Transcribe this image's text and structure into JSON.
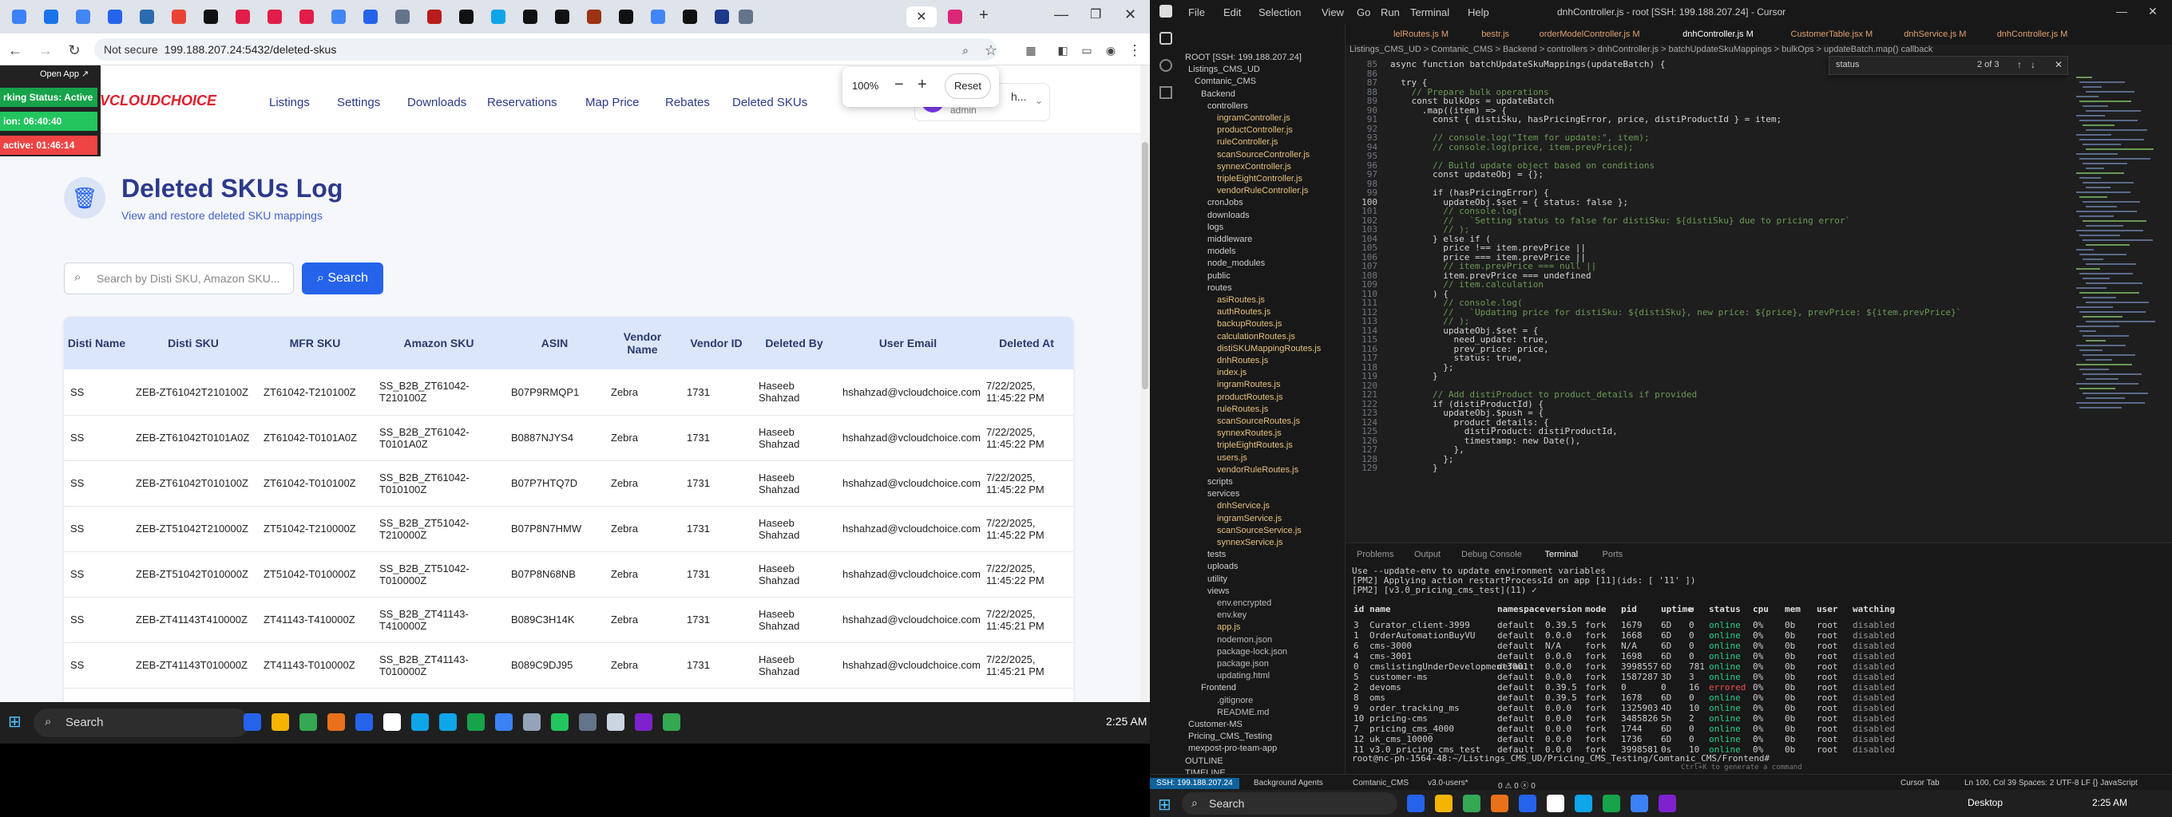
{
  "browser": {
    "url": "199.188.207.24:5432/deleted-skus",
    "not_secure": "Not secure",
    "zoom_value": "100%",
    "zoom_minus": "−",
    "zoom_plus": "+",
    "zoom_reset": "Reset",
    "open_app": "Open App ↗"
  },
  "status_widget": {
    "status": "rking Status: Active",
    "break": "ion: 06:40:40",
    "active": "active: 01:46:14"
  },
  "site": {
    "logo": "VCLOUDCHOICE",
    "nav": [
      "Listings",
      "Settings",
      "Downloads",
      "Reservations",
      "Map Price",
      "Rebates",
      "Deleted SKUs"
    ],
    "user_name": "h...",
    "user_role": "admin"
  },
  "page": {
    "title": "Deleted SKUs Log",
    "subtitle": "View and restore deleted SKU mappings",
    "search_placeholder": "Search by Disti SKU, Amazon SKU...",
    "search_button": "Search"
  },
  "table": {
    "headers": [
      "Disti Name",
      "Disti SKU",
      "MFR SKU",
      "Amazon SKU",
      "ASIN",
      "Vendor Name",
      "Vendor ID",
      "Deleted By",
      "User Email",
      "Deleted At"
    ],
    "rows": [
      [
        "SS",
        "ZEB-ZT61042T210100Z",
        "ZT61042-T210100Z",
        "SS_B2B_ZT61042-T210100Z",
        "B07P9RMQP1",
        "Zebra",
        "1731",
        "Haseeb Shahzad",
        "hshahzad@vcloudchoice.com",
        "7/22/2025, 11:45:22 PM"
      ],
      [
        "SS",
        "ZEB-ZT61042T0101A0Z",
        "ZT61042-T0101A0Z",
        "SS_B2B_ZT61042-T0101A0Z",
        "B0887NJYS4",
        "Zebra",
        "1731",
        "Haseeb Shahzad",
        "hshahzad@vcloudchoice.com",
        "7/22/2025, 11:45:22 PM"
      ],
      [
        "SS",
        "ZEB-ZT61042T010100Z",
        "ZT61042-T010100Z",
        "SS_B2B_ZT61042-T010100Z",
        "B07P7HTQ7D",
        "Zebra",
        "1731",
        "Haseeb Shahzad",
        "hshahzad@vcloudchoice.com",
        "7/22/2025, 11:45:22 PM"
      ],
      [
        "SS",
        "ZEB-ZT51042T210000Z",
        "ZT51042-T210000Z",
        "SS_B2B_ZT51042-T210000Z",
        "B07P8N7HMW",
        "Zebra",
        "1731",
        "Haseeb Shahzad",
        "hshahzad@vcloudchoice.com",
        "7/22/2025, 11:45:22 PM"
      ],
      [
        "SS",
        "ZEB-ZT51042T010000Z",
        "ZT51042-T010000Z",
        "SS_B2B_ZT51042-T010000Z",
        "B07P8N68NB",
        "Zebra",
        "1731",
        "Haseeb Shahzad",
        "hshahzad@vcloudchoice.com",
        "7/22/2025, 11:45:22 PM"
      ],
      [
        "SS",
        "ZEB-ZT41143T410000Z",
        "ZT41143-T410000Z",
        "SS_B2B_ZT41143-T410000Z",
        "B089C3H14K",
        "Zebra",
        "1731",
        "Haseeb Shahzad",
        "hshahzad@vcloudchoice.com",
        "7/22/2025, 11:45:21 PM"
      ],
      [
        "SS",
        "ZEB-ZT41143T010000Z",
        "ZT41143-T010000Z",
        "SS_B2B_ZT41143-T010000Z",
        "B089C9DJ95",
        "Zebra",
        "1731",
        "Haseeb Shahzad",
        "hshahzad@vcloudchoice.com",
        "7/22/2025, 11:45:21 PM"
      ]
    ]
  },
  "taskbar_left": {
    "search": "Search",
    "time": "2:25 AM"
  },
  "editor": {
    "title": "dnhController.js - root [SSH: 199.188.207.24] - Cursor",
    "menus": [
      "File",
      "Edit",
      "Selection",
      "View",
      "Go",
      "Run",
      "Terminal",
      "Help"
    ],
    "tabs": [
      "lelRoutes.js M",
      "bestr.js",
      "orderModelController.js M",
      "dnhController.js M",
      "CustomerTable.jsx M",
      "dnhService.js M",
      "dnhController.js M"
    ],
    "breadcrumb": "Listings_CMS_UD > Comtanic_CMS > Backend > controllers > dnhController.js > batchUpdateSkuMappings > bulkOps > updateBatch.map() callback",
    "find_text": "status",
    "find_count": "2 of 3",
    "files": [
      "ROOT [SSH: 199.188.207.24]",
      "Listings_CMS_UD",
      "Comtanic_CMS",
      "Backend",
      "controllers",
      "ingramController.js",
      "productController.js",
      "ruleController.js",
      "scanSourceController.js",
      "synnexController.js",
      "tripleEightController.js",
      "vendorRuleController.js",
      "cronJobs",
      "downloads",
      "logs",
      "middleware",
      "models",
      "node_modules",
      "public",
      "routes",
      "asiRoutes.js",
      "authRoutes.js",
      "backupRoutes.js",
      "calculationRoutes.js",
      "distiSKUMappingRoutes.js",
      "dnhRoutes.js",
      "index.js",
      "ingramRoutes.js",
      "productRoutes.js",
      "ruleRoutes.js",
      "scanSourceRoutes.js",
      "synnexRoutes.js",
      "tripleEightRoutes.js",
      "users.js",
      "vendorRuleRoutes.js",
      "scripts",
      "services",
      "dnhService.js",
      "ingramService.js",
      "scanSourceService.js",
      "synnexService.js",
      "tests",
      "uploads",
      "utility",
      "views",
      "env.encrypted",
      "env.key",
      "app.js",
      "nodemon.json",
      "package-lock.json",
      "package.json",
      "updating.html",
      "Frontend",
      ".gitignore",
      "README.md",
      "Customer-MS",
      "Pricing_CMS_Testing",
      "mexpost-pro-team-app",
      "OUTLINE",
      "TIMELINE"
    ],
    "code_start_line": 85,
    "code": [
      "async function batchUpdateSkuMappings(updateBatch) {",
      "",
      "  try {",
      "    // Prepare bulk operations",
      "    const bulkOps = updateBatch",
      "      .map((item) => {",
      "        const { distiSku, hasPricingError, price, distiProductId } = item;",
      "",
      "        // console.log(\"Item for update:\", item);",
      "        // console.log(price, item.prevPrice);",
      "",
      "        // Build update object based on conditions",
      "        const updateObj = {};",
      "",
      "        if (hasPricingError) {",
      "          updateObj.$set = { status: false };",
      "          // console.log(",
      "          //   `Setting status to false for distiSku: ${distiSku} due to pricing error`",
      "          // );",
      "        } else if (",
      "          price !== item.prevPrice ||",
      "          price === item.prevPrice ||",
      "          // item.prevPrice === null ||",
      "          item.prevPrice === undefined",
      "          // item.calculation",
      "        ) {",
      "          // console.log(",
      "          //   `Updating price for distiSku: ${distiSku}, new price: ${price}, prevPrice: ${item.prevPrice}`",
      "          // );",
      "          updateObj.$set = {",
      "            need_update: true,",
      "            prev_price: price,",
      "            status: true,",
      "          };",
      "        }",
      "",
      "        // Add distiProduct to product_details if provided",
      "        if (distiProductId) {",
      "          updateObj.$push = {",
      "            product_details: {",
      "              distiProduct: distiProductId,",
      "              timestamp: new Date(),",
      "            },",
      "          };",
      "        }"
    ],
    "panel_tabs": [
      "Problems",
      "Output",
      "Debug Console",
      "Terminal",
      "Ports"
    ],
    "terminal_intro": [
      "Use --update-env to update environment variables",
      "[PM2] Applying action restartProcessId on app [11](ids: [ '11' ])",
      "[PM2] [v3.0_pricing_cms_test](11) ✓"
    ],
    "pm2_headers": [
      "id",
      "name",
      "namespace",
      "version",
      "mode",
      "pid",
      "uptime",
      "↺",
      "status",
      "cpu",
      "mem",
      "user",
      "watching"
    ],
    "pm2_rows": [
      [
        "3",
        "Curator_client-3999",
        "default",
        "0.39.5",
        "fork",
        "1679",
        "6D",
        "0",
        "online",
        "0%",
        "0b",
        "root",
        "disabled"
      ],
      [
        "1",
        "OrderAutomationBuyVU",
        "default",
        "0.0.0",
        "fork",
        "1668",
        "6D",
        "0",
        "online",
        "0%",
        "0b",
        "root",
        "disabled"
      ],
      [
        "6",
        "cms-3000",
        "default",
        "N/A",
        "fork",
        "N/A",
        "6D",
        "0",
        "online",
        "0%",
        "0b",
        "root",
        "disabled"
      ],
      [
        "4",
        "cms-3001",
        "default",
        "0.0.0",
        "fork",
        "1698",
        "6D",
        "0",
        "online",
        "0%",
        "0b",
        "root",
        "disabled"
      ],
      [
        "0",
        "cmslistingUnderDevelopment3001",
        "default",
        "0.0.0",
        "fork",
        "3998557",
        "6D",
        "781",
        "online",
        "0%",
        "0b",
        "root",
        "disabled"
      ],
      [
        "5",
        "customer-ms",
        "default",
        "0.0.0",
        "fork",
        "1587287",
        "3D",
        "3",
        "online",
        "0%",
        "0b",
        "root",
        "disabled"
      ],
      [
        "2",
        "devoms",
        "default",
        "0.39.5",
        "fork",
        "0",
        "0",
        "16",
        "errored",
        "0%",
        "0b",
        "root",
        "disabled"
      ],
      [
        "8",
        "oms",
        "default",
        "0.39.5",
        "fork",
        "1678",
        "6D",
        "0",
        "online",
        "0%",
        "0b",
        "root",
        "disabled"
      ],
      [
        "9",
        "order_tracking_ms",
        "default",
        "0.0.0",
        "fork",
        "1325903",
        "4D",
        "10",
        "online",
        "0%",
        "0b",
        "root",
        "disabled"
      ],
      [
        "10",
        "pricing-cms",
        "default",
        "0.0.0",
        "fork",
        "3485826",
        "5h",
        "2",
        "online",
        "0%",
        "0b",
        "root",
        "disabled"
      ],
      [
        "7",
        "pricing_cms_4000",
        "default",
        "0.0.0",
        "fork",
        "1744",
        "6D",
        "0",
        "online",
        "0%",
        "0b",
        "root",
        "disabled"
      ],
      [
        "12",
        "uk_cms_10000",
        "default",
        "0.0.0",
        "fork",
        "1736",
        "6D",
        "0",
        "online",
        "0%",
        "0b",
        "root",
        "disabled"
      ],
      [
        "11",
        "v3.0_pricing_cms_test",
        "default",
        "0.0.0",
        "fork",
        "3998581",
        "0s",
        "10",
        "online",
        "0%",
        "0b",
        "root",
        "disabled"
      ]
    ],
    "prompt": "root@nc-ph-1564-48:~/Listings_CMS_UD/Pricing_CMS_Testing/Comtanic_CMS/Frontend# ",
    "terminal_hint": "Ctrl+K to generate a command",
    "status_left": "SSH: 199.188.207.24",
    "status_items": [
      "Background Agents",
      "Comtanic_CMS",
      "v3.0-users*",
      "0 ⚠ 0 ⓧ 0"
    ],
    "status_right": "Ln 100, Col 39   Spaces: 2   UTF-8   LF   {} JavaScript",
    "cursor_tab": "Cursor Tab",
    "right_area": "Desktop"
  },
  "taskbar_right": {
    "search": "Search",
    "time": "2:25 AM"
  }
}
